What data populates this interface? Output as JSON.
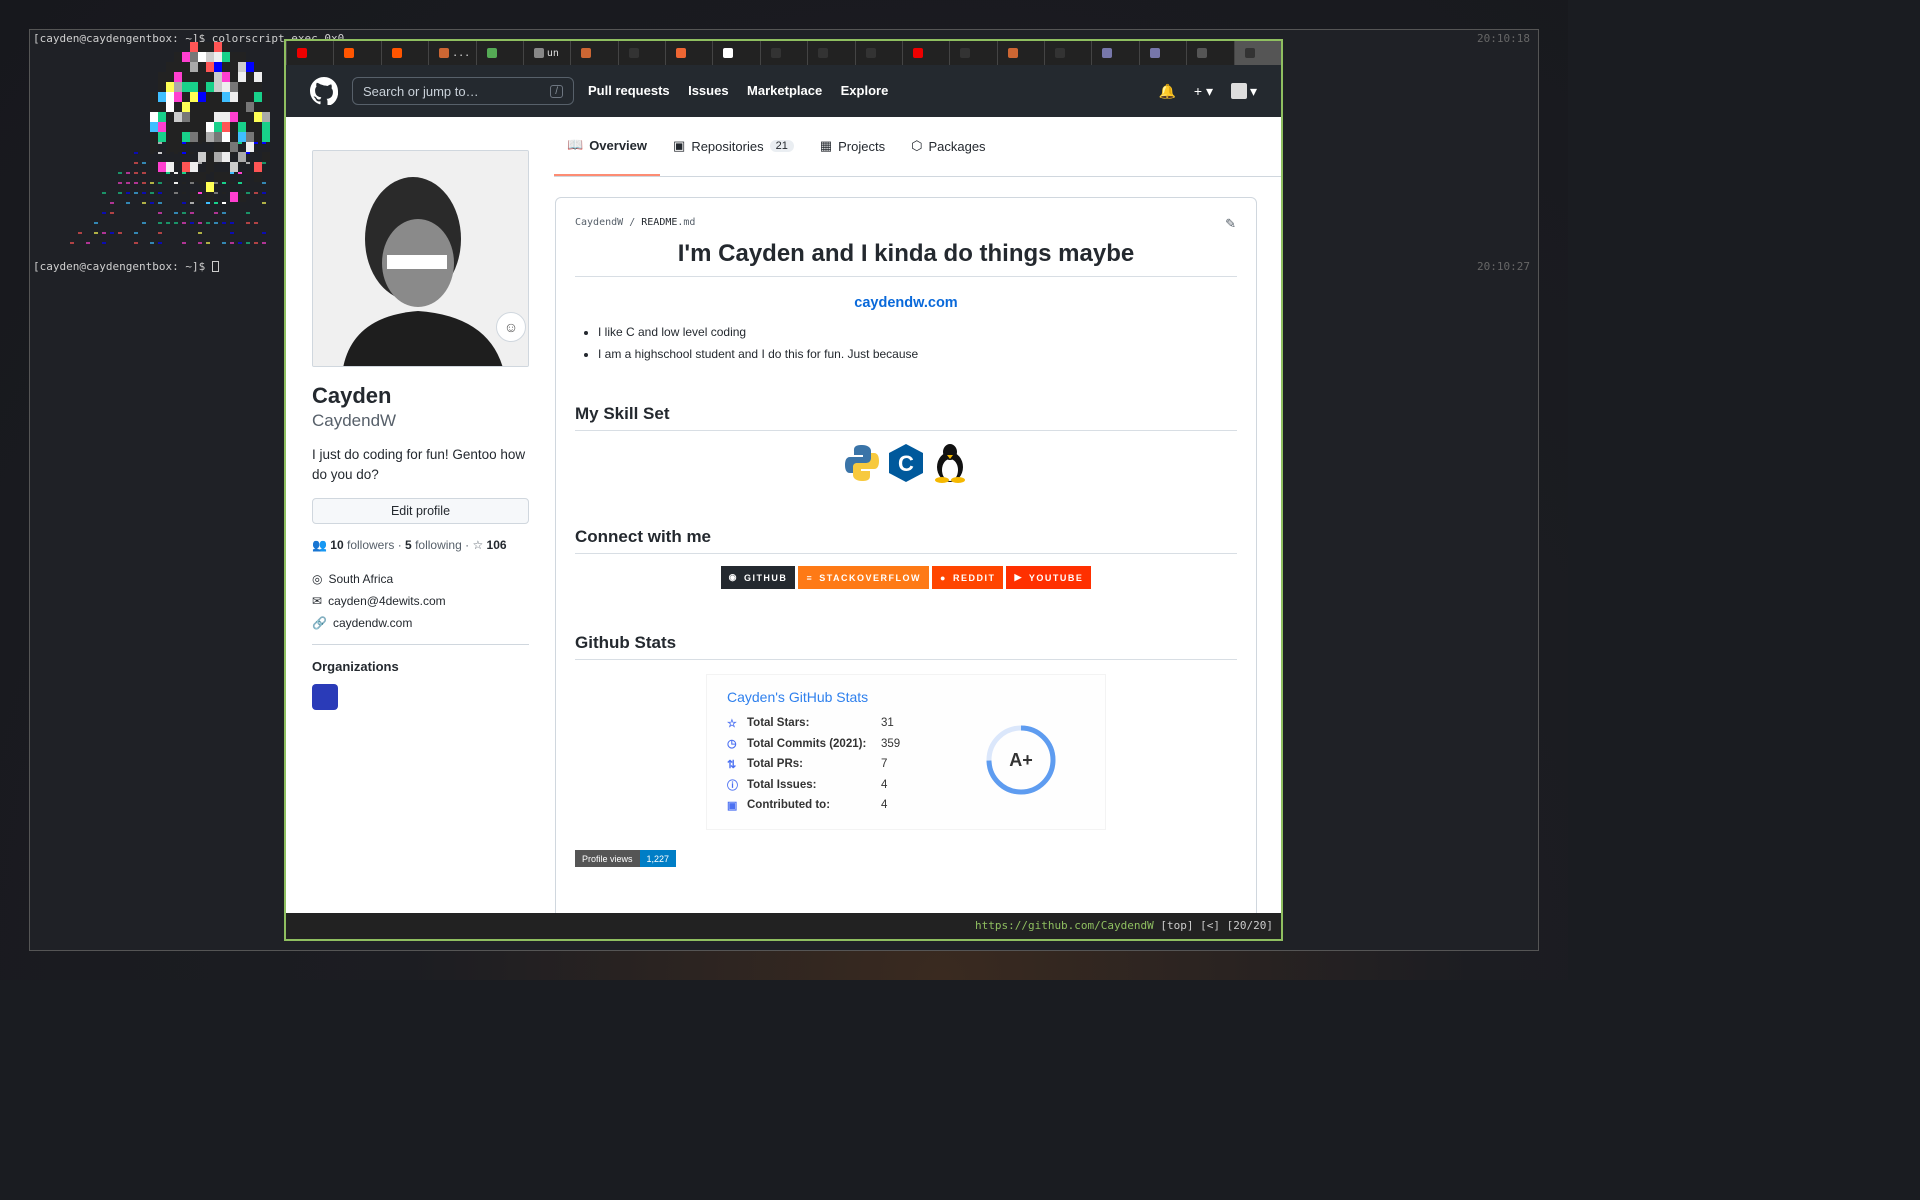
{
  "terminal": {
    "line1": "[cayden@caydengentbox: ~]$ colorscript exec 0x0",
    "time1": "20:10:18",
    "line2": "[cayden@caydengentbox: ~]$ ",
    "time2": "20:10:27"
  },
  "tabs": [
    "",
    "",
    "",
    "...",
    "",
    "un",
    "",
    "",
    "",
    "",
    "",
    "",
    "",
    "",
    "",
    "",
    "",
    "",
    "",
    "",
    ""
  ],
  "github": {
    "search_placeholder": "Search or jump to…",
    "search_key": "/",
    "nav": [
      "Pull requests",
      "Issues",
      "Marketplace",
      "Explore"
    ]
  },
  "profile_tabs": {
    "overview": "Overview",
    "repositories": "Repositories",
    "repo_count": "21",
    "projects": "Projects",
    "packages": "Packages"
  },
  "profile": {
    "name": "Cayden",
    "login": "CaydendW",
    "bio": "I just do coding for fun! Gentoo how do you do?",
    "edit": "Edit profile",
    "followers": "10",
    "followers_label": "followers",
    "following": "5",
    "following_label": "following",
    "stars": "106",
    "location": "South Africa",
    "email": "cayden@4dewits.com",
    "website": "caydendw.com",
    "orgs_heading": "Organizations"
  },
  "readme": {
    "path_user": "CaydendW",
    "path_sep": "/",
    "path_file": "README",
    "path_ext": ".md",
    "title": "I'm Cayden and I kinda do things maybe",
    "site": "caydendw.com",
    "bullets": [
      "I like C and low level coding",
      "I am a highschool student and I do this for fun. Just because"
    ],
    "skills_heading": "My Skill Set",
    "connect_heading": "Connect with me",
    "badges": [
      "GITHUB",
      "STACKOVERFLOW",
      "REDDIT",
      "YOUTUBE"
    ],
    "stats_heading": "Github Stats",
    "stats_card": {
      "title": "Cayden's GitHub Stats",
      "rows": [
        {
          "label": "Total Stars:",
          "value": "31"
        },
        {
          "label": "Total Commits (2021):",
          "value": "359"
        },
        {
          "label": "Total PRs:",
          "value": "7"
        },
        {
          "label": "Total Issues:",
          "value": "4"
        },
        {
          "label": "Contributed to:",
          "value": "4"
        }
      ],
      "grade": "A+"
    },
    "views_label": "Profile views",
    "views_value": "1,227"
  },
  "statusbar": {
    "url": "https://github.com/CaydendW",
    "info": " [top] [<] [20/20]"
  },
  "colors": {
    "github_header": "#24292f",
    "accent_tab": "#fd8c73",
    "link": "#0969da",
    "browser_border": "#8fbf60",
    "badge_github": "#24292f",
    "badge_stackoverflow": "#fe7a16",
    "badge_reddit": "#ff4500",
    "badge_youtube": "#ff0000"
  }
}
